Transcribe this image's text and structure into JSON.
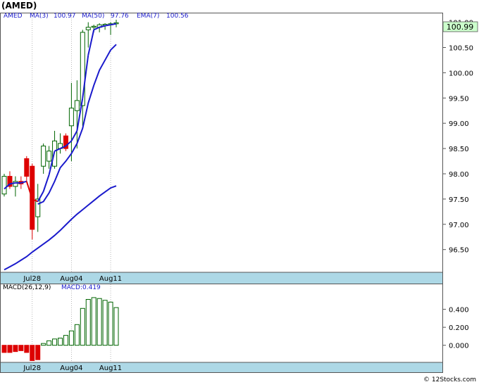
{
  "header": {
    "ticker_title": "(AMED)"
  },
  "legend": {
    "symbol": "AMED",
    "ma3_label": "MA(3)",
    "ma3_value": "100.97",
    "ma50_label": "MA(50)",
    "ma50_value": "97.76",
    "ema7_label": "EMA(7)",
    "ema7_value": "100.56"
  },
  "last_price_badge": "100.99",
  "macd_legend": {
    "label": "MACD(26,12,9)",
    "value_label": "MACD:0.419"
  },
  "watermark": "© 12Stocks.com",
  "colors": {
    "up_candle": "#006400",
    "down_candle": "#dd0000",
    "ma_line": "#1a1acc",
    "axis_band": "#add8e6",
    "badge_bg": "#ccffcc"
  },
  "chart_data": [
    {
      "type": "candlestick",
      "title": "(AMED)",
      "ylim": [
        96.05,
        101.05
      ],
      "y_ticks": [
        "101.00",
        "100.50",
        "100.00",
        "99.50",
        "99.00",
        "98.50",
        "98.00",
        "97.50",
        "97.00",
        "96.50"
      ],
      "x_tick_labels": [
        "Jul28",
        "Aug04",
        "Aug11"
      ],
      "x_tick_index": [
        5,
        12,
        19
      ],
      "candles": [
        {
          "o": 97.6,
          "h": 98.0,
          "l": 97.55,
          "c": 97.95
        },
        {
          "o": 97.95,
          "h": 98.05,
          "l": 97.7,
          "c": 97.75
        },
        {
          "o": 97.75,
          "h": 97.95,
          "l": 97.55,
          "c": 97.85
        },
        {
          "o": 97.85,
          "h": 97.95,
          "l": 97.7,
          "c": 97.8
        },
        {
          "o": 98.3,
          "h": 98.35,
          "l": 97.85,
          "c": 97.95
        },
        {
          "o": 98.15,
          "h": 98.2,
          "l": 96.7,
          "c": 96.9
        },
        {
          "o": 97.15,
          "h": 97.8,
          "l": 96.85,
          "c": 97.5
        },
        {
          "o": 98.15,
          "h": 98.6,
          "l": 98.0,
          "c": 98.55
        },
        {
          "o": 98.25,
          "h": 98.55,
          "l": 98.1,
          "c": 98.45
        },
        {
          "o": 98.15,
          "h": 98.85,
          "l": 98.1,
          "c": 98.65
        },
        {
          "o": 98.5,
          "h": 98.8,
          "l": 98.4,
          "c": 98.6
        },
        {
          "o": 98.75,
          "h": 98.8,
          "l": 98.45,
          "c": 98.5
        },
        {
          "o": 98.95,
          "h": 99.8,
          "l": 98.25,
          "c": 99.3
        },
        {
          "o": 99.25,
          "h": 99.85,
          "l": 98.5,
          "c": 99.45
        },
        {
          "o": 99.35,
          "h": 100.85,
          "l": 98.95,
          "c": 100.8
        },
        {
          "o": 100.85,
          "h": 101.0,
          "l": 100.5,
          "c": 100.9
        },
        {
          "o": 100.9,
          "h": 100.95,
          "l": 100.8,
          "c": 100.92
        },
        {
          "o": 100.9,
          "h": 100.98,
          "l": 100.8,
          "c": 100.95
        },
        {
          "o": 100.95,
          "h": 100.98,
          "l": 100.85,
          "c": 100.96
        },
        {
          "o": 100.97,
          "h": 101.0,
          "l": 100.75,
          "c": 100.97
        },
        {
          "o": 100.98,
          "h": 101.05,
          "l": 100.9,
          "c": 100.99
        }
      ],
      "series": [
        {
          "name": "MA(3)",
          "values": [
            97.7,
            97.8,
            97.82,
            97.82,
            97.85,
            97.5,
            97.45,
            97.65,
            97.98,
            98.45,
            98.5,
            98.55,
            98.65,
            98.85,
            99.5,
            100.35,
            100.85,
            100.9,
            100.93,
            100.95,
            100.97
          ]
        },
        {
          "name": "MA(50)",
          "values": [
            96.1,
            96.16,
            96.22,
            96.29,
            96.36,
            96.45,
            96.53,
            96.61,
            96.69,
            96.78,
            96.88,
            96.99,
            97.1,
            97.2,
            97.29,
            97.38,
            97.47,
            97.56,
            97.64,
            97.72,
            97.76
          ]
        },
        {
          "name": "EMA(7)",
          "values": null
        }
      ],
      "ema_values_from_index": 5,
      "ema_values": [
        97.4,
        97.45,
        97.62,
        97.85,
        98.12,
        98.25,
        98.4,
        98.6,
        98.9,
        99.4,
        99.75,
        100.05,
        100.25,
        100.45,
        100.56
      ],
      "ema_start_index": 6
    },
    {
      "type": "bar",
      "title": "MACD(26,12,9)",
      "ylim": [
        -0.19,
        0.6
      ],
      "y_ticks": [
        "0.400",
        "0.200",
        "0.000"
      ],
      "x_tick_labels": [
        "Jul28",
        "Aug04",
        "Aug11"
      ],
      "x_tick_index": [
        5,
        12,
        19
      ],
      "values": [
        -0.08,
        -0.08,
        -0.07,
        -0.06,
        -0.08,
        -0.17,
        -0.16,
        0.02,
        0.05,
        0.07,
        0.08,
        0.11,
        0.16,
        0.23,
        0.41,
        0.51,
        0.53,
        0.52,
        0.5,
        0.48,
        0.419
      ]
    }
  ]
}
